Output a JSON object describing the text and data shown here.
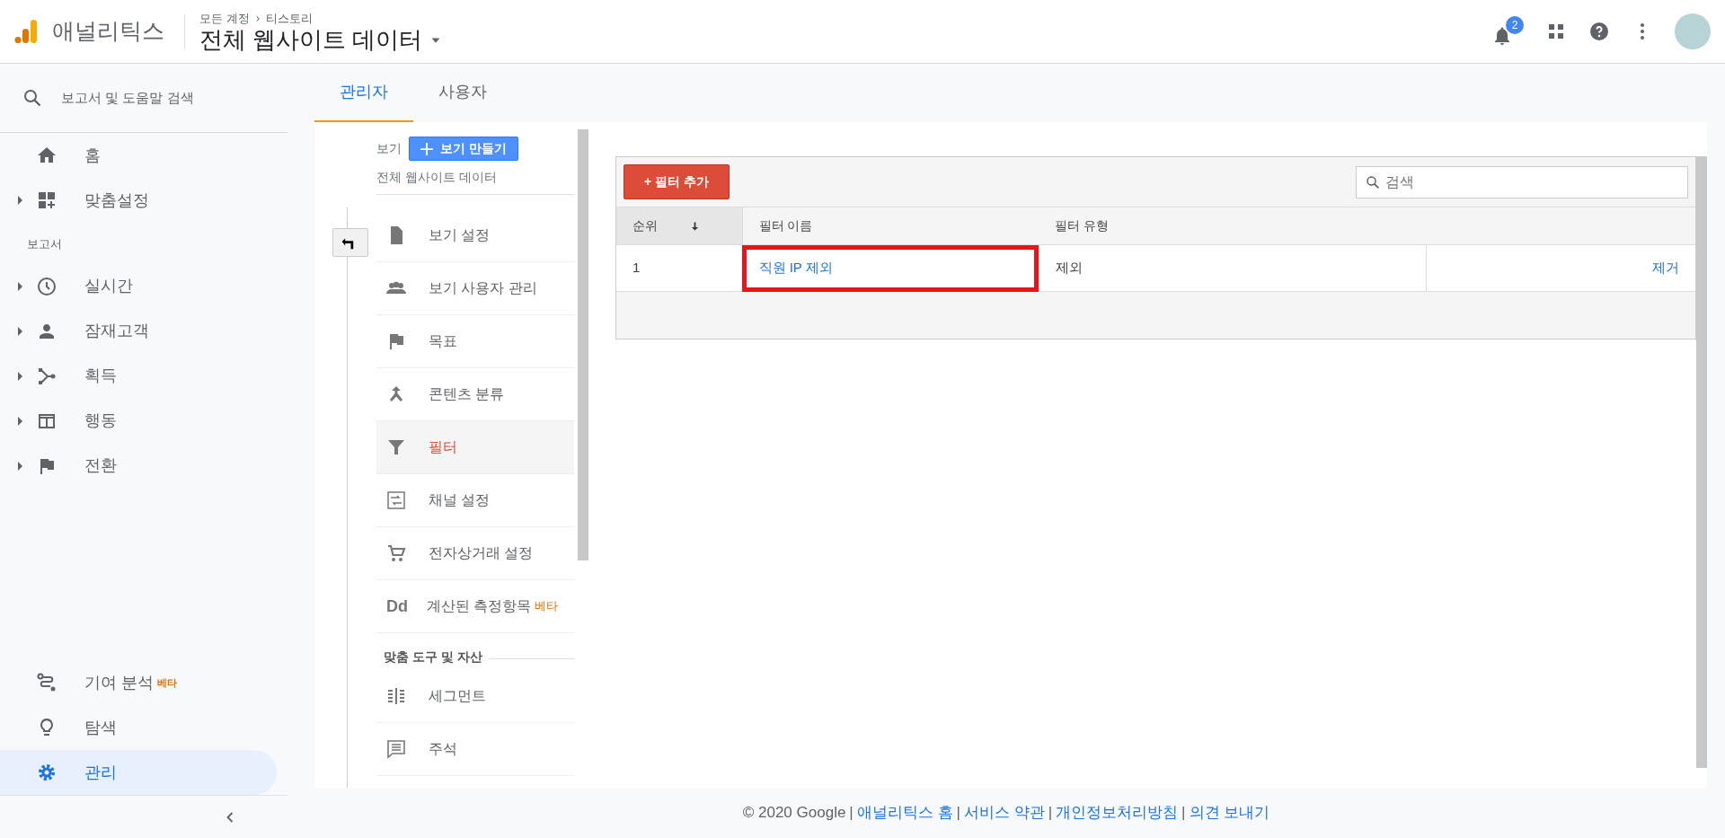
{
  "header": {
    "product": "애널리틱스",
    "breadcrumb": [
      "모든 계정",
      "티스토리"
    ],
    "property": "전체 웹사이트 데이터",
    "notification_count": "2"
  },
  "sidebar": {
    "search_label": "보고서 및 도움말 검색",
    "items": [
      {
        "kind": "item",
        "label": "홈",
        "expandable": false,
        "selected": false
      },
      {
        "kind": "item",
        "label": "맞춤설정",
        "expandable": true,
        "selected": false
      },
      {
        "kind": "section",
        "label": "보고서"
      },
      {
        "kind": "item",
        "label": "실시간",
        "expandable": true,
        "selected": false
      },
      {
        "kind": "item",
        "label": "잠재고객",
        "expandable": true,
        "selected": false
      },
      {
        "kind": "item",
        "label": "획득",
        "expandable": true,
        "selected": false
      },
      {
        "kind": "item",
        "label": "행동",
        "expandable": true,
        "selected": false
      },
      {
        "kind": "item",
        "label": "전환",
        "expandable": true,
        "selected": false
      }
    ],
    "bottom_items": [
      {
        "label": "기여 분석",
        "badge": "베타",
        "selected": false
      },
      {
        "label": "탐색",
        "selected": false
      },
      {
        "label": "관리",
        "selected": true
      }
    ]
  },
  "tabs": [
    {
      "label": "관리자",
      "selected": true
    },
    {
      "label": "사용자",
      "selected": false
    }
  ],
  "view_panel": {
    "label": "보기",
    "create_button": "보기 만들기",
    "view_name": "전체 웹사이트 데이터",
    "items": [
      {
        "kind": "item",
        "label": "보기 설정",
        "selected": false
      },
      {
        "kind": "item",
        "label": "보기 사용자 관리",
        "selected": false
      },
      {
        "kind": "item",
        "label": "목표",
        "selected": false
      },
      {
        "kind": "item",
        "label": "콘텐츠 분류",
        "selected": false
      },
      {
        "kind": "item",
        "label": "필터",
        "selected": true
      },
      {
        "kind": "item",
        "label": "채널 설정",
        "selected": false
      },
      {
        "kind": "item",
        "label": "전자상거래 설정",
        "selected": false
      },
      {
        "kind": "item",
        "label": "계산된 측정항목",
        "icon_text": "Dd",
        "badge": "베타",
        "selected": false
      },
      {
        "kind": "section",
        "label": "맞춤 도구 및 자산"
      },
      {
        "kind": "item",
        "label": "세그먼트",
        "selected": false
      },
      {
        "kind": "item",
        "label": "주석",
        "selected": false
      }
    ]
  },
  "filters": {
    "add_button": "+ 필터 추가",
    "search_placeholder": "검색",
    "columns": [
      "순위",
      "필터 이름",
      "필터 유형"
    ],
    "rows": [
      {
        "rank": "1",
        "name": "직원 IP 제외",
        "type": "제외",
        "action": "제거",
        "highlighted": true
      }
    ]
  },
  "footer": {
    "copyright": "© 2020 Google",
    "links": [
      {
        "separator": "|",
        "label": "애널리틱스 홈"
      },
      {
        "separator": "|",
        "label": "서비스 약관"
      },
      {
        "separator": "|",
        "label": "개인정보처리방침"
      },
      {
        "separator": "|",
        "label": "의견 보내기"
      }
    ]
  }
}
